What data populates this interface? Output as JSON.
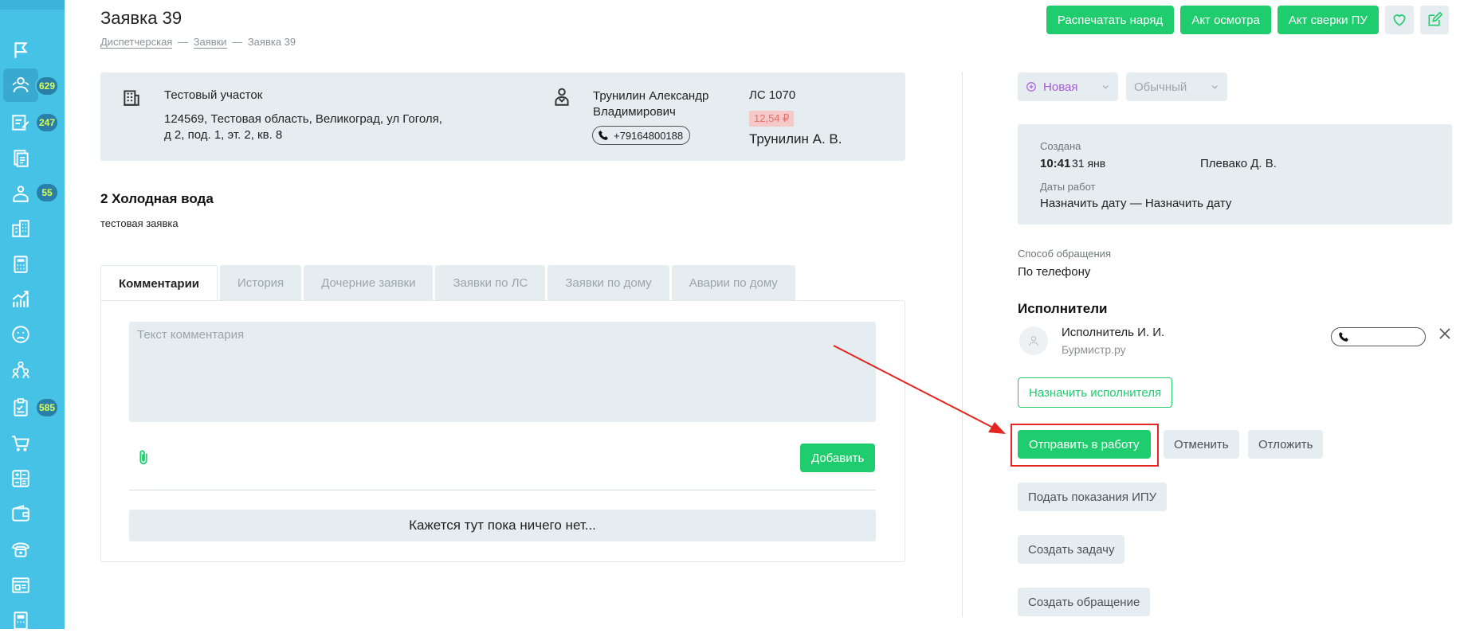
{
  "sidebar": {
    "badges": [
      "629",
      "247",
      "55",
      "585"
    ]
  },
  "header": {
    "title": "Заявка 39",
    "breadcrumb": [
      "Диспетчерская",
      "Заявки",
      "Заявка 39"
    ],
    "breadcrumb_sep": "—",
    "actions": [
      "Распечатать наряд",
      "Акт осмотра",
      "Акт сверки ПУ"
    ]
  },
  "info": {
    "location_name": "Тестовый участок",
    "address_line1": "124569, Тестовая область, Великоград, ул Гоголя,",
    "address_line2": "д 2, под. 1, эт. 2, кв. 8",
    "owner_line1": "Трунилин Александр",
    "owner_line2": "Владимирович",
    "phone": "+79164800188",
    "account": "ЛС 1070",
    "debt": "12,54 ₽",
    "owner_short": "Трунилин А. В."
  },
  "issue": {
    "title": "2 Холодная вода",
    "description": "тестовая заявка"
  },
  "tabs": [
    "Комментарии",
    "История",
    "Дочерние заявки",
    "Заявки по ЛС",
    "Заявки по дому",
    "Аварии по дому"
  ],
  "comments": {
    "placeholder": "Текст комментария",
    "add_label": "Добавить",
    "empty_text": "Кажется тут пока ничего нет..."
  },
  "status": {
    "status_label": "Новая",
    "priority_label": "Обычный"
  },
  "meta": {
    "created_label": "Создана",
    "created_time": "10:41",
    "created_date": "31 янв",
    "created_by": "Плевако Д. В.",
    "work_dates_label": "Даты работ",
    "work_dates_value": "Назначить дату — Назначить дату"
  },
  "contact": {
    "label": "Способ обращения",
    "value": "По телефону"
  },
  "executors": {
    "heading": "Исполнители",
    "name": "Исполнитель И. И.",
    "org": "Бурмистр.ру",
    "assign_label": "Назначить исполнителя"
  },
  "actions": {
    "send_label": "Отправить в работу",
    "cancel_label": "Отменить",
    "postpone_label": "Отложить",
    "readings_label": "Подать показания ИПУ",
    "task_label": "Создать задачу",
    "appeal_label": "Создать обращение"
  },
  "colors": {
    "sidebar": "#46c2e6",
    "accent": "#1fcc6e",
    "highlight": "#e3261f",
    "status": "#a45bd6"
  }
}
